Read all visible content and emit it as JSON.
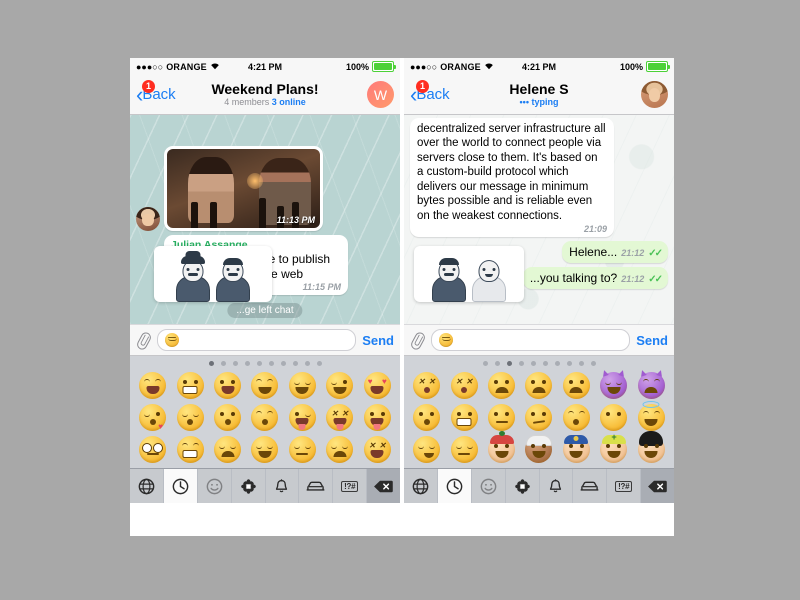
{
  "app": {
    "kind": "telegram-ios-chat-screenshots",
    "panel_count": 2
  },
  "status_bar": {
    "signal_dots": "●●●○○",
    "carrier": "ORANGE",
    "wifi_icon": "wifi-icon",
    "time": "4:21 PM",
    "battery_percent": "100%"
  },
  "left_panel": {
    "nav": {
      "back_label": "Back",
      "back_badge": "1",
      "title": "Weekend Plans!",
      "subtitle_members": "4 members",
      "subtitle_online": "3 online",
      "avatar_initial": "W"
    },
    "messages": [
      {
        "type": "photo",
        "timestamp": "11:13 PM",
        "has_avatar": true
      },
      {
        "type": "text",
        "sender": "Julian Assange",
        "text": "Sorry guys, I'll have to publish this chat logs on the web",
        "timestamp": "11:15 PM"
      }
    ],
    "sticker_preview": {
      "name": "chaplin-tesla-sticker",
      "figures": [
        "charlie-chaplin",
        "nikola-tesla"
      ]
    },
    "service_message": "...ge left chat",
    "input": {
      "attach_icon": "paperclip-icon",
      "emoji_icon": "relieved-face-icon",
      "placeholder": "",
      "value": "",
      "send_label": "Send"
    },
    "keyboard": {
      "page_count": 10,
      "active_page": 1,
      "emoji": [
        {
          "name": "grinning-squinting-face",
          "style": "",
          "mouth": "open",
          "eyes": "arc"
        },
        {
          "name": "grinning-face",
          "style": "",
          "mouth": "teeth",
          "eyes": "dot"
        },
        {
          "name": "smiling-face-open-mouth",
          "style": "",
          "mouth": "open",
          "eyes": "dot"
        },
        {
          "name": "smiling-face-smiling-eyes",
          "style": "",
          "mouth": "open",
          "eyes": "arc"
        },
        {
          "name": "relieved-face",
          "style": "",
          "mouth": "smile",
          "eyes": "arcd"
        },
        {
          "name": "winking-face",
          "style": "",
          "mouth": "smile",
          "eyes": "wink"
        },
        {
          "name": "heart-eyes-face",
          "style": "",
          "mouth": "open",
          "eyes": "heart"
        },
        {
          "name": "face-blowing-a-kiss",
          "style": "",
          "mouth": "kiss",
          "eyes": "arcd"
        },
        {
          "name": "kissing-face-closed-eyes",
          "style": "",
          "mouth": "kiss",
          "eyes": "arcd"
        },
        {
          "name": "kissing-face",
          "style": "",
          "mouth": "kiss",
          "eyes": "dot"
        },
        {
          "name": "kissing-smiling-eyes",
          "style": "",
          "mouth": "kiss",
          "eyes": "arc"
        },
        {
          "name": "winking-face-tongue",
          "style": "",
          "mouth": "tongue",
          "eyes": "wink"
        },
        {
          "name": "squinting-face-tongue",
          "style": "",
          "mouth": "tongue",
          "eyes": "x"
        },
        {
          "name": "face-with-tongue",
          "style": "",
          "mouth": "tongue",
          "eyes": "dot"
        },
        {
          "name": "flushed-face",
          "style": "",
          "mouth": "flat",
          "eyes": "big"
        },
        {
          "name": "grimacing-face",
          "style": "",
          "mouth": "teeth",
          "eyes": "arc"
        },
        {
          "name": "pensive-face",
          "style": "",
          "mouth": "frown",
          "eyes": "arcd"
        },
        {
          "name": "relieved-face-2",
          "style": "",
          "mouth": "smile",
          "eyes": "arcd"
        },
        {
          "name": "unamused-face",
          "style": "",
          "mouth": "flat",
          "eyes": "flat"
        },
        {
          "name": "disappointed-face",
          "style": "",
          "mouth": "frown",
          "eyes": "arcd"
        },
        {
          "name": "confounded-face",
          "style": "",
          "mouth": "open",
          "eyes": "x"
        }
      ],
      "toolbar": [
        {
          "name": "globe-icon",
          "selected": false
        },
        {
          "name": "clock-recent-icon",
          "selected": true
        },
        {
          "name": "smiley-icon",
          "selected": false,
          "dim": true
        },
        {
          "name": "flower-nature-icon",
          "selected": false
        },
        {
          "name": "bell-icon",
          "selected": false
        },
        {
          "name": "car-icon",
          "selected": false
        },
        {
          "name": "symbols-icon",
          "selected": false,
          "label": "!?#"
        },
        {
          "name": "backspace-icon",
          "selected": false
        }
      ]
    }
  },
  "right_panel": {
    "nav": {
      "back_label": "Back",
      "back_badge": "1",
      "title": "Helene S",
      "subtitle": "typing",
      "avatar_initial": ""
    },
    "messages": [
      {
        "type": "text",
        "direction": "in",
        "text": "decentralized server infrastructure all over the world to connect people via servers close to them. It's based on a custom-build protocol which delivers our message in minimum bytes possible and is reliable even on the weakest connections.",
        "timestamp": "21:09"
      },
      {
        "type": "text",
        "direction": "out",
        "text": "Helene...",
        "timestamp": "21:12",
        "checks": "✓✓"
      },
      {
        "type": "text",
        "direction": "out",
        "text": "...you talking to?",
        "timestamp": "21:12",
        "checks": "✓✓"
      }
    ],
    "sticker_preview": {
      "name": "freud-gandhi-sticker",
      "figures": [
        "sigmund-freud",
        "mahatma-gandhi"
      ]
    },
    "input": {
      "attach_icon": "paperclip-icon",
      "emoji_icon": "smirking-face-icon",
      "placeholder": "",
      "value": "",
      "send_label": "Send"
    },
    "keyboard": {
      "page_count": 10,
      "active_page": 3,
      "emoji": [
        {
          "name": "dizzy-face",
          "style": "",
          "mouth": "o",
          "eyes": "x"
        },
        {
          "name": "dizzy-face-2",
          "style": "",
          "mouth": "o",
          "eyes": "x"
        },
        {
          "name": "frowning-face-open-eyes",
          "style": "",
          "mouth": "frown",
          "eyes": "dot"
        },
        {
          "name": "slightly-frowning-face",
          "style": "",
          "mouth": "frown",
          "eyes": "dot"
        },
        {
          "name": "anguished-face",
          "style": "",
          "mouth": "frown",
          "eyes": "dot"
        },
        {
          "name": "smiling-face-with-horns",
          "style": "purple",
          "mouth": "smile",
          "eyes": "arcd"
        },
        {
          "name": "angry-face-with-horns",
          "style": "purple",
          "mouth": "frown",
          "eyes": "angry"
        },
        {
          "name": "hushed-face",
          "style": "",
          "mouth": "o",
          "eyes": "dot"
        },
        {
          "name": "grimacing-face-2",
          "style": "",
          "mouth": "teeth",
          "eyes": "dot"
        },
        {
          "name": "neutral-face",
          "style": "",
          "mouth": "flat",
          "eyes": "dot"
        },
        {
          "name": "confused-face",
          "style": "",
          "mouth": "flat",
          "eyes": "dot"
        },
        {
          "name": "astonished-face",
          "style": "",
          "mouth": "o",
          "eyes": "arc"
        },
        {
          "name": "no-mouth-face",
          "style": "",
          "mouth": "none",
          "eyes": "dot"
        },
        {
          "name": "smiling-face-with-halo",
          "style": "",
          "mouth": "smile",
          "eyes": "arc"
        },
        {
          "name": "smirking-face",
          "style": "",
          "mouth": "smirk",
          "eyes": "arcd"
        },
        {
          "name": "expressionless-face",
          "style": "",
          "mouth": "flat",
          "eyes": "flat"
        },
        {
          "name": "man-with-gua-pi-mao",
          "style": "skin",
          "mouth": "smile",
          "eyes": "dot",
          "hat": "red"
        },
        {
          "name": "man-with-turban",
          "style": "skin2",
          "mouth": "smile",
          "eyes": "dot",
          "hat": "white"
        },
        {
          "name": "police-officer",
          "style": "skin",
          "mouth": "smile",
          "eyes": "dot",
          "hat": "blue"
        },
        {
          "name": "construction-worker",
          "style": "skin",
          "mouth": "smile",
          "eyes": "dot",
          "hat": "helmet"
        },
        {
          "name": "guardsman",
          "style": "skin",
          "mouth": "smile",
          "eyes": "dot",
          "hat": "black"
        }
      ],
      "toolbar": [
        {
          "name": "globe-icon",
          "selected": false
        },
        {
          "name": "clock-recent-icon",
          "selected": true
        },
        {
          "name": "smiley-icon",
          "selected": false,
          "dim": true
        },
        {
          "name": "flower-nature-icon",
          "selected": false
        },
        {
          "name": "bell-icon",
          "selected": false
        },
        {
          "name": "car-icon",
          "selected": false
        },
        {
          "name": "symbols-icon",
          "selected": false,
          "label": "!?#"
        },
        {
          "name": "backspace-icon",
          "selected": false
        }
      ]
    }
  },
  "colors": {
    "accent_blue": "#1c7ef3",
    "sender_green": "#27ae60",
    "out_bubble": "#e3f8d4",
    "check_green": "#4cc258",
    "badge_red": "#ff2d20",
    "chat_teal": "#b9d4d2",
    "keyboard_gray": "#d0d3d8",
    "letterbox_gray": "#a8a8a8"
  }
}
